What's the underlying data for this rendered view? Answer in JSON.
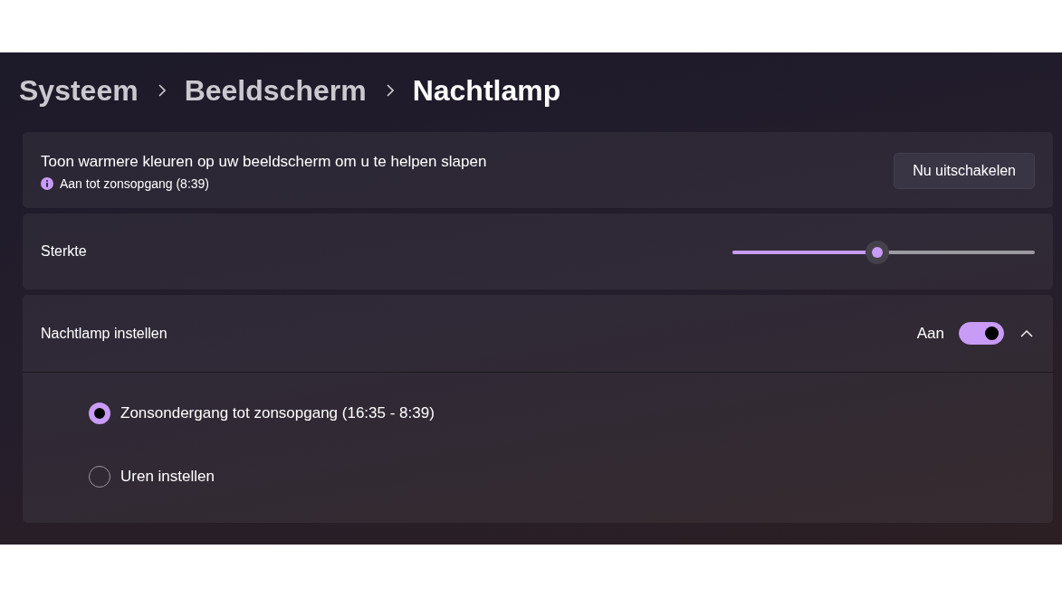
{
  "breadcrumb": [
    {
      "label": "Systeem",
      "current": false
    },
    {
      "label": "Beeldscherm",
      "current": false
    },
    {
      "label": "Nachtlamp",
      "current": true
    }
  ],
  "status_card": {
    "description": "Toon warmere kleuren op uw beeldscherm om u te helpen slapen",
    "status": "Aan tot zonsopgang (8:39)",
    "button": "Nu uitschakelen"
  },
  "strength": {
    "label": "Sterkte",
    "level": 0.48
  },
  "schedule": {
    "label": "Nachtlamp instellen",
    "toggle_label": "Aan",
    "on": true,
    "expanded": true,
    "options": [
      {
        "label": "Zonsondergang tot zonsopgang (16:35 - 8:39)",
        "selected": true
      },
      {
        "label": "Uren instellen",
        "selected": false
      }
    ]
  }
}
